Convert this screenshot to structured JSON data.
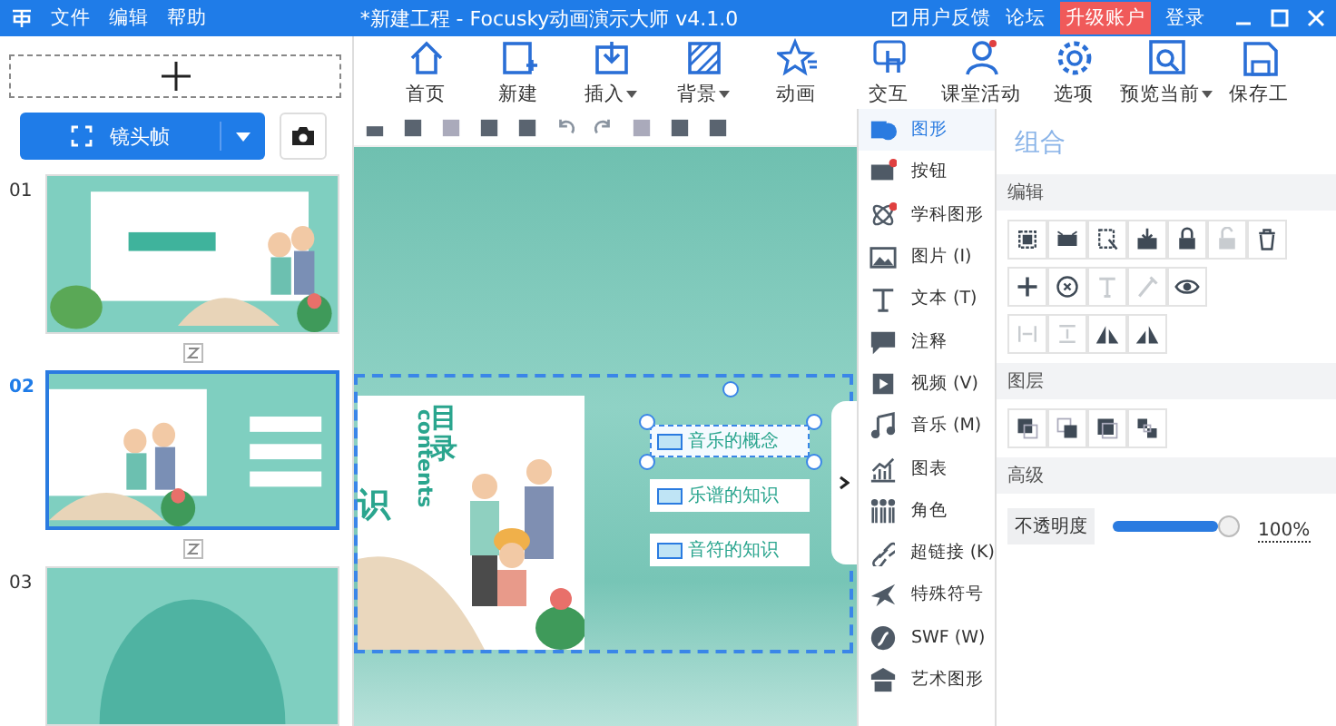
{
  "window": {
    "title": "*新建工程 - Focusky动画演示大师  v4.1.0",
    "menu": [
      "文件",
      "编辑",
      "帮助"
    ],
    "links": [
      {
        "label": "用户反馈",
        "kind": "feedback"
      },
      {
        "label": "论坛",
        "kind": "plain"
      },
      {
        "label": "升级账户",
        "kind": "upgrade"
      },
      {
        "label": "登录",
        "kind": "plain"
      }
    ]
  },
  "toolbar": [
    {
      "label": "首页",
      "dropdown": false
    },
    {
      "label": "新建",
      "dropdown": false
    },
    {
      "label": "插入",
      "dropdown": true
    },
    {
      "label": "背景",
      "dropdown": true
    },
    {
      "label": "动画",
      "dropdown": false
    },
    {
      "label": "交互",
      "dropdown": false
    },
    {
      "label": "课堂活动",
      "dropdown": false
    },
    {
      "label": "选项",
      "dropdown": false
    },
    {
      "label": "预览当前",
      "dropdown": true
    },
    {
      "label": "保存工",
      "dropdown": false
    }
  ],
  "frames": {
    "button": "镜头帧",
    "slides": [
      {
        "number": "01",
        "selected": false
      },
      {
        "number": "02",
        "selected": true
      },
      {
        "number": "03",
        "selected": false
      }
    ]
  },
  "slide": {
    "heading": "目录",
    "subheading": "contents",
    "fragment": "识",
    "items": [
      {
        "label": "音乐的概念",
        "selected": true
      },
      {
        "label": "乐谱的知识",
        "selected": false
      },
      {
        "label": "音符的知识",
        "selected": false
      }
    ]
  },
  "insert_menu": [
    {
      "label": "图形",
      "selected": true
    },
    {
      "label": "按钮",
      "selected": false
    },
    {
      "label": "学科图形",
      "selected": false
    },
    {
      "label": "图片 (I)",
      "selected": false
    },
    {
      "label": "文本 (T)",
      "selected": false
    },
    {
      "label": "注释",
      "selected": false
    },
    {
      "label": "视频 (V)",
      "selected": false
    },
    {
      "label": "音乐 (M)",
      "selected": false
    },
    {
      "label": "图表",
      "selected": false
    },
    {
      "label": "角色",
      "selected": false
    },
    {
      "label": "超链接 (K)",
      "selected": false
    },
    {
      "label": "特殊符号",
      "selected": false
    },
    {
      "label": "SWF (W)",
      "selected": false
    },
    {
      "label": "艺术图形",
      "selected": false
    }
  ],
  "properties": {
    "title": "组合",
    "sections": [
      {
        "title": "编辑",
        "rows": [
          [
            {
              "disabled": false
            },
            {
              "disabled": false
            },
            {
              "disabled": false
            },
            {
              "disabled": false
            },
            {
              "disabled": false
            },
            {
              "disabled": true
            },
            {
              "disabled": false
            }
          ],
          [
            {
              "disabled": false
            },
            {
              "disabled": false
            },
            {
              "disabled": true
            },
            {
              "disabled": true
            },
            {
              "disabled": false
            }
          ],
          [
            {
              "disabled": true
            },
            {
              "disabled": true
            },
            {
              "disabled": false
            },
            {
              "disabled": false
            }
          ]
        ]
      },
      {
        "title": "图层",
        "rows": [
          [
            {
              "disabled": false
            },
            {
              "disabled": false
            },
            {
              "disabled": false
            },
            {
              "disabled": false
            }
          ]
        ]
      },
      {
        "title": "高级"
      }
    ],
    "opacity": {
      "label": "不透明度",
      "level": 1.0,
      "reading": "100%"
    }
  }
}
